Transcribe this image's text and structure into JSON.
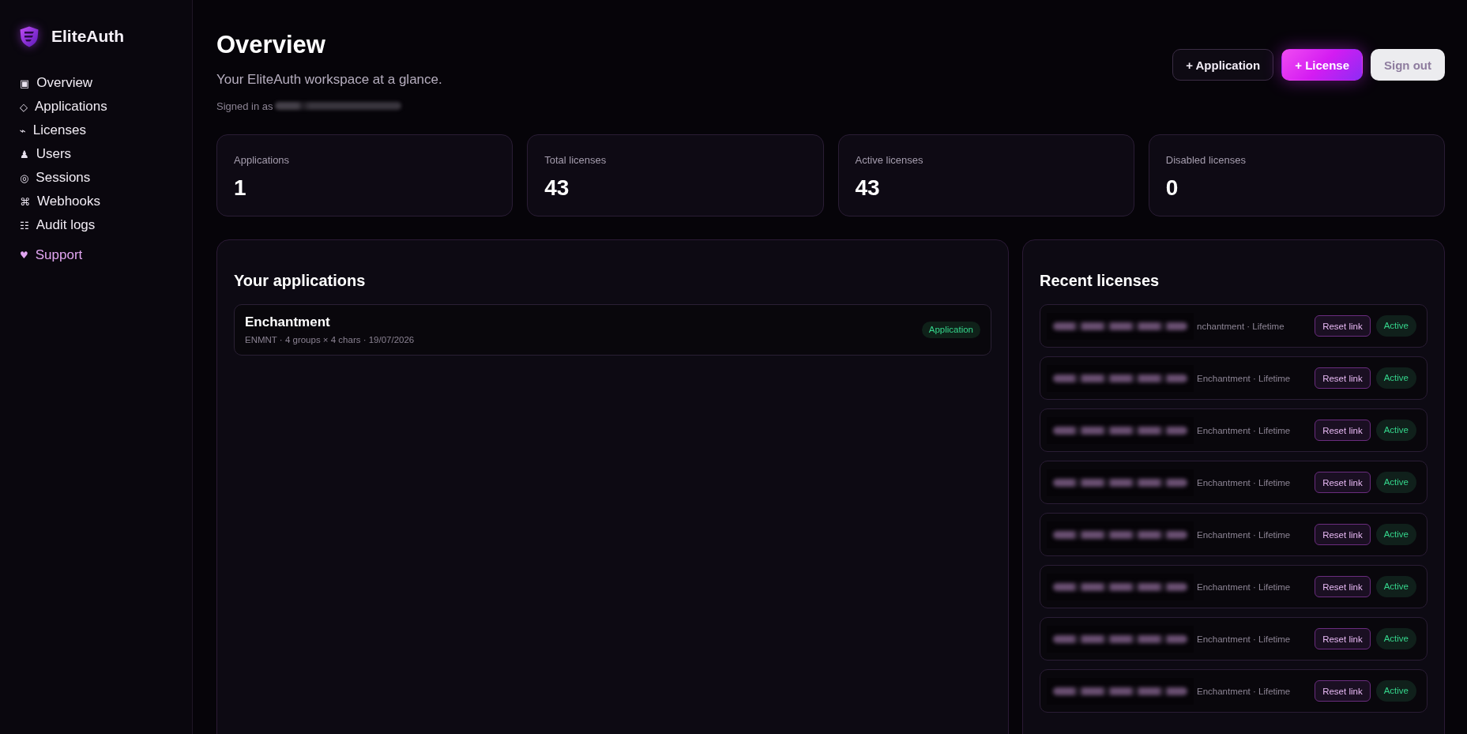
{
  "sidebar": {
    "logo_text": "EliteAuth",
    "nav": [
      {
        "icon": "▣",
        "label": "Overview"
      },
      {
        "icon": "◇",
        "label": "Applications"
      },
      {
        "icon": "⌁",
        "label": "Licenses"
      },
      {
        "icon": "♟",
        "label": "Users"
      },
      {
        "icon": "◎",
        "label": "Sessions"
      },
      {
        "icon": "⌘",
        "label": "Webhooks"
      },
      {
        "icon": "☷",
        "label": "Audit logs"
      }
    ],
    "support": {
      "icon": "♥",
      "label": "Support"
    }
  },
  "header": {
    "title": "Overview",
    "subtitle": "Your EliteAuth workspace at a glance.",
    "signed_in": "Signed in as",
    "actions": [
      {
        "label": "+ Application",
        "kind": "secondary"
      },
      {
        "label": "+ License",
        "kind": "primary"
      },
      {
        "label": "Sign out",
        "kind": "light"
      }
    ]
  },
  "stats": [
    {
      "label": "Applications",
      "value": "1"
    },
    {
      "label": "Total licenses",
      "value": "43"
    },
    {
      "label": "Active licenses",
      "value": "43"
    },
    {
      "label": "Disabled licenses",
      "value": "0"
    }
  ],
  "applications": {
    "title": "Your applications",
    "items": [
      {
        "name": "Enchantment",
        "meta": "ENMNT · 4 groups × 4 chars · 19/07/2026",
        "badge": "Application"
      }
    ]
  },
  "recent_licenses": {
    "title": "Recent licenses",
    "items": [
      {
        "meta": "nchantment · Lifetime",
        "action": "Reset link",
        "status": "Active"
      },
      {
        "meta": "Enchantment · Lifetime",
        "action": "Reset link",
        "status": "Active"
      },
      {
        "meta": "Enchantment · Lifetime",
        "action": "Reset link",
        "status": "Active"
      },
      {
        "meta": "Enchantment · Lifetime",
        "action": "Reset link",
        "status": "Active"
      },
      {
        "meta": "Enchantment · Lifetime",
        "action": "Reset link",
        "status": "Active"
      },
      {
        "meta": "Enchantment · Lifetime",
        "action": "Reset link",
        "status": "Active"
      },
      {
        "meta": "Enchantment · Lifetime",
        "action": "Reset link",
        "status": "Active"
      },
      {
        "meta": "Enchantment · Lifetime",
        "action": "Reset link",
        "status": "Active"
      }
    ]
  }
}
